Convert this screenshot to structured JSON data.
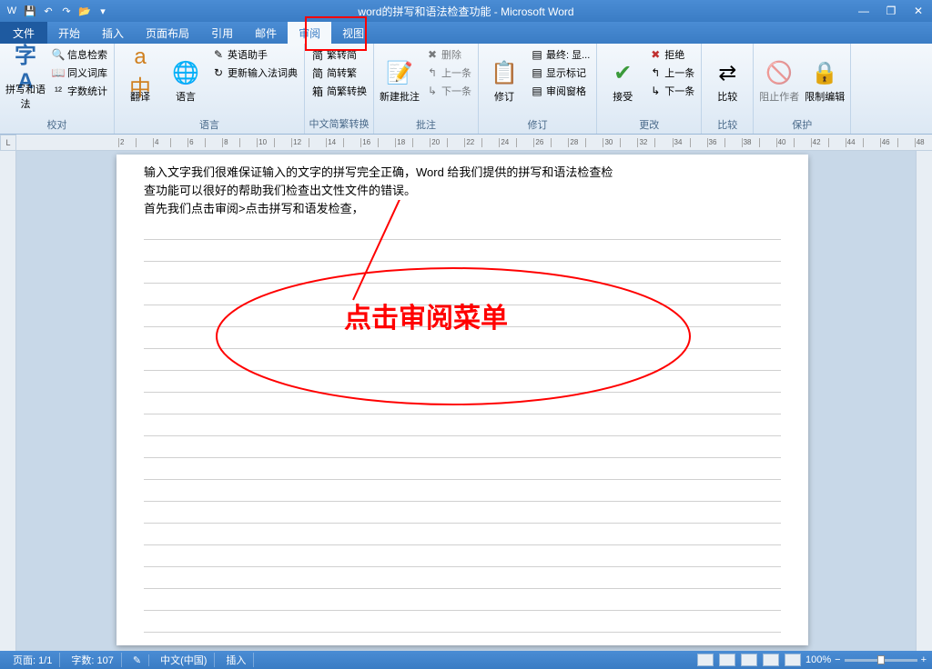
{
  "title": "word的拼写和语法检查功能 - Microsoft Word",
  "qat_icons": [
    "word-icon",
    "save-icon",
    "undo-icon",
    "redo-icon",
    "open-icon"
  ],
  "tabs": {
    "file": "文件",
    "items": [
      "开始",
      "插入",
      "页面布局",
      "引用",
      "邮件",
      "审阅",
      "视图"
    ],
    "active_index": 5
  },
  "ribbon": {
    "groups": [
      {
        "label": "校对",
        "big": [
          {
            "icon": "✔",
            "text": "拼写和语法"
          }
        ],
        "small": [
          {
            "icon": "🔍",
            "text": "信息检索"
          },
          {
            "icon": "📖",
            "text": "同义词库"
          },
          {
            "icon": "12",
            "text": "字数统计"
          }
        ]
      },
      {
        "label": "语言",
        "big": [
          {
            "icon": "中",
            "text": "翻译"
          },
          {
            "icon": "🌐",
            "text": "语言"
          }
        ],
        "small": [
          {
            "icon": "✎",
            "text": "英语助手"
          },
          {
            "icon": "↻",
            "text": "更新输入法词典"
          }
        ]
      },
      {
        "label": "中文简繁转换",
        "small": [
          {
            "icon": "简",
            "text": "繁转简"
          },
          {
            "icon": "简",
            "text": "简转繁"
          },
          {
            "icon": "箱",
            "text": "简繁转换"
          }
        ]
      },
      {
        "label": "批注",
        "big": [
          {
            "icon": "📝",
            "text": "新建批注"
          }
        ],
        "small": [
          {
            "icon": "✖",
            "text": "删除"
          },
          {
            "icon": "←",
            "text": "上一条"
          },
          {
            "icon": "→",
            "text": "下一条"
          }
        ]
      },
      {
        "label": "修订",
        "big": [
          {
            "icon": "📋",
            "text": "修订"
          }
        ],
        "small": [
          {
            "icon": "▤",
            "text": "最终: 显..."
          },
          {
            "icon": "▤",
            "text": "显示标记"
          },
          {
            "icon": "▤",
            "text": "审阅窗格"
          }
        ]
      },
      {
        "label": "更改",
        "big": [
          {
            "icon": "✔",
            "text": "接受"
          }
        ],
        "small": [
          {
            "icon": "✖",
            "text": "拒绝"
          },
          {
            "icon": "←",
            "text": "上一条"
          },
          {
            "icon": "→",
            "text": "下一条"
          }
        ]
      },
      {
        "label": "比较",
        "big": [
          {
            "icon": "⇄",
            "text": "比较"
          }
        ]
      },
      {
        "label": "保护",
        "big": [
          {
            "icon": "🚫",
            "text": "阻止作者"
          },
          {
            "icon": "🔒",
            "text": "限制编辑"
          }
        ]
      }
    ]
  },
  "document": {
    "line1": "输入文字我们很难保证输入的文字的拼写完全正确，Word 给我们提供的拼写和语法检查检",
    "line2": "查功能可以很好的帮助我们检查出文性文件的错误。",
    "line3": "首先我们点击审阅>点击拼写和语发检查，"
  },
  "annotation": "点击审阅菜单",
  "status": {
    "page": "页面: 1/1",
    "words": "字数: 107",
    "lang": "中文(中国)",
    "mode": "插入",
    "zoom": "100%",
    "zoom_minus": "−",
    "zoom_plus": "+"
  },
  "ruler_corner": "L",
  "ruler_marks": [
    "2",
    "",
    "4",
    "",
    "6",
    "",
    "8",
    "",
    "10",
    "",
    "12",
    "",
    "14",
    "",
    "16",
    "",
    "18",
    "",
    "20",
    "",
    "22",
    "",
    "24",
    "",
    "26",
    "",
    "28",
    "",
    "30",
    "",
    "32",
    "",
    "34",
    "",
    "36",
    "",
    "38",
    "",
    "40",
    "",
    "42",
    "",
    "44",
    "",
    "46",
    "",
    "48"
  ]
}
